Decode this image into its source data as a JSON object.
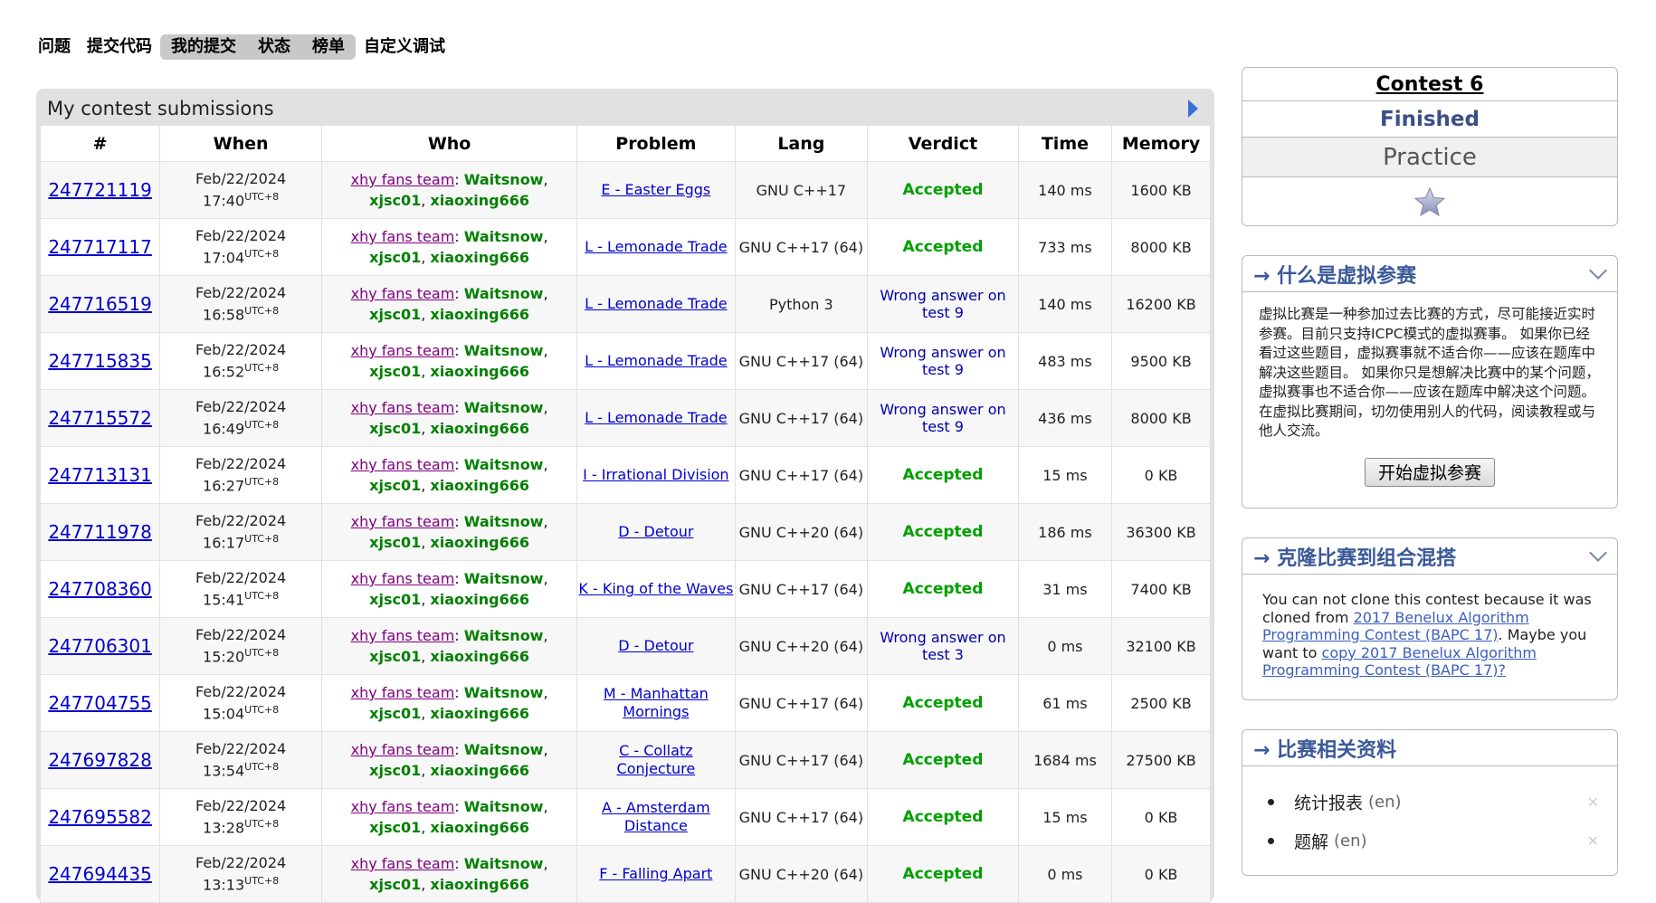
{
  "menu": {
    "items": [
      "问题",
      "提交代码"
    ],
    "highlighted": [
      "我的提交",
      "状态",
      "榜单"
    ],
    "last": "自定义调试"
  },
  "panel": {
    "title": "My contest submissions"
  },
  "table": {
    "headers": [
      "#",
      "When",
      "Who",
      "Problem",
      "Lang",
      "Verdict",
      "Time",
      "Memory"
    ],
    "rows": [
      {
        "id": "247721119",
        "date": "Feb/22/2024",
        "time": "17:40",
        "utc": "UTC+8",
        "team": "xhy fans team",
        "m1": "Waitsnow",
        "m2": "xjsc01",
        "m3": "xiaoxing666",
        "problem": "E - Easter Eggs",
        "lang": "GNU C++17",
        "verdict": "Accepted",
        "ok": true,
        "exec": "140 ms",
        "mem": "1600 KB"
      },
      {
        "id": "247717117",
        "date": "Feb/22/2024",
        "time": "17:04",
        "utc": "UTC+8",
        "team": "xhy fans team",
        "m1": "Waitsnow",
        "m2": "xjsc01",
        "m3": "xiaoxing666",
        "problem": "L - Lemonade Trade",
        "lang": "GNU C++17 (64)",
        "verdict": "Accepted",
        "ok": true,
        "exec": "733 ms",
        "mem": "8000 KB"
      },
      {
        "id": "247716519",
        "date": "Feb/22/2024",
        "time": "16:58",
        "utc": "UTC+8",
        "team": "xhy fans team",
        "m1": "Waitsnow",
        "m2": "xjsc01",
        "m3": "xiaoxing666",
        "problem": "L - Lemonade Trade",
        "lang": "Python 3",
        "verdict": "Wrong answer on test 9",
        "ok": false,
        "exec": "140 ms",
        "mem": "16200 KB"
      },
      {
        "id": "247715835",
        "date": "Feb/22/2024",
        "time": "16:52",
        "utc": "UTC+8",
        "team": "xhy fans team",
        "m1": "Waitsnow",
        "m2": "xjsc01",
        "m3": "xiaoxing666",
        "problem": "L - Lemonade Trade",
        "lang": "GNU C++17 (64)",
        "verdict": "Wrong answer on test 9",
        "ok": false,
        "exec": "483 ms",
        "mem": "9500 KB"
      },
      {
        "id": "247715572",
        "date": "Feb/22/2024",
        "time": "16:49",
        "utc": "UTC+8",
        "team": "xhy fans team",
        "m1": "Waitsnow",
        "m2": "xjsc01",
        "m3": "xiaoxing666",
        "problem": "L - Lemonade Trade",
        "lang": "GNU C++17 (64)",
        "verdict": "Wrong answer on test 9",
        "ok": false,
        "exec": "436 ms",
        "mem": "8000 KB"
      },
      {
        "id": "247713131",
        "date": "Feb/22/2024",
        "time": "16:27",
        "utc": "UTC+8",
        "team": "xhy fans team",
        "m1": "Waitsnow",
        "m2": "xjsc01",
        "m3": "xiaoxing666",
        "problem": "I - Irrational Division",
        "lang": "GNU C++17 (64)",
        "verdict": "Accepted",
        "ok": true,
        "exec": "15 ms",
        "mem": "0 KB"
      },
      {
        "id": "247711978",
        "date": "Feb/22/2024",
        "time": "16:17",
        "utc": "UTC+8",
        "team": "xhy fans team",
        "m1": "Waitsnow",
        "m2": "xjsc01",
        "m3": "xiaoxing666",
        "problem": "D - Detour",
        "lang": "GNU C++20 (64)",
        "verdict": "Accepted",
        "ok": true,
        "exec": "186 ms",
        "mem": "36300 KB"
      },
      {
        "id": "247708360",
        "date": "Feb/22/2024",
        "time": "15:41",
        "utc": "UTC+8",
        "team": "xhy fans team",
        "m1": "Waitsnow",
        "m2": "xjsc01",
        "m3": "xiaoxing666",
        "problem": "K - King of the Waves",
        "lang": "GNU C++17 (64)",
        "verdict": "Accepted",
        "ok": true,
        "exec": "31 ms",
        "mem": "7400 KB"
      },
      {
        "id": "247706301",
        "date": "Feb/22/2024",
        "time": "15:20",
        "utc": "UTC+8",
        "team": "xhy fans team",
        "m1": "Waitsnow",
        "m2": "xjsc01",
        "m3": "xiaoxing666",
        "problem": "D - Detour",
        "lang": "GNU C++20 (64)",
        "verdict": "Wrong answer on test 3",
        "ok": false,
        "exec": "0 ms",
        "mem": "32100 KB"
      },
      {
        "id": "247704755",
        "date": "Feb/22/2024",
        "time": "15:04",
        "utc": "UTC+8",
        "team": "xhy fans team",
        "m1": "Waitsnow",
        "m2": "xjsc01",
        "m3": "xiaoxing666",
        "problem": "M - Manhattan Mornings",
        "lang": "GNU C++17 (64)",
        "verdict": "Accepted",
        "ok": true,
        "exec": "61 ms",
        "mem": "2500 KB"
      },
      {
        "id": "247697828",
        "date": "Feb/22/2024",
        "time": "13:54",
        "utc": "UTC+8",
        "team": "xhy fans team",
        "m1": "Waitsnow",
        "m2": "xjsc01",
        "m3": "xiaoxing666",
        "problem": "C - Collatz Conjecture",
        "lang": "GNU C++17 (64)",
        "verdict": "Accepted",
        "ok": true,
        "exec": "1684 ms",
        "mem": "27500 KB"
      },
      {
        "id": "247695582",
        "date": "Feb/22/2024",
        "time": "13:28",
        "utc": "UTC+8",
        "team": "xhy fans team",
        "m1": "Waitsnow",
        "m2": "xjsc01",
        "m3": "xiaoxing666",
        "problem": "A - Amsterdam Distance",
        "lang": "GNU C++17 (64)",
        "verdict": "Accepted",
        "ok": true,
        "exec": "15 ms",
        "mem": "0 KB"
      },
      {
        "id": "247694435",
        "date": "Feb/22/2024",
        "time": "13:13",
        "utc": "UTC+8",
        "team": "xhy fans team",
        "m1": "Waitsnow",
        "m2": "xjsc01",
        "m3": "xiaoxing666",
        "problem": "F - Falling Apart",
        "lang": "GNU C++20 (64)",
        "verdict": "Accepted",
        "ok": true,
        "exec": "0 ms",
        "mem": "0 KB"
      }
    ]
  },
  "contest": {
    "name": "Contest 6",
    "phase": "Finished",
    "mode": "Practice",
    "star_icon": "star-icon"
  },
  "virtual": {
    "title": "→ 什么是虚拟参赛",
    "text": "虚拟比赛是一种参加过去比赛的方式，尽可能接近实时参赛。目前只支持ICPC模式的虚拟赛事。 如果你已经看过这些题目，虚拟赛事就不适合你——应该在题库中解决这些题目。 如果你只是想解决比赛中的某个问题，虚拟赛事也不适合你——应该在题库中解决这个问题。 在虚拟比赛期间，切勿使用别人的代码，阅读教程或与他人交流。",
    "button": "开始虚拟参赛"
  },
  "clone": {
    "title": "→ 克隆比赛到组合混搭",
    "text_before": "You can not clone this contest because it was cloned from ",
    "link1": "2017 Benelux Algorithm Programming Contest (BAPC 17)",
    "text_mid": ". Maybe you want to ",
    "link2": "copy 2017 Benelux Algorithm Programming Contest (BAPC 17)?"
  },
  "materials": {
    "title": "→ 比赛相关资料",
    "items": [
      {
        "label": "统计报表",
        "lang": "(en)"
      },
      {
        "label": "题解",
        "lang": "(en)"
      }
    ]
  },
  "colors": {
    "accepted": "#00a000",
    "wrong": "#0000aa",
    "team": "#800080",
    "member": "#008000",
    "link": "#0000cc",
    "widget_title": "#3b5998"
  }
}
